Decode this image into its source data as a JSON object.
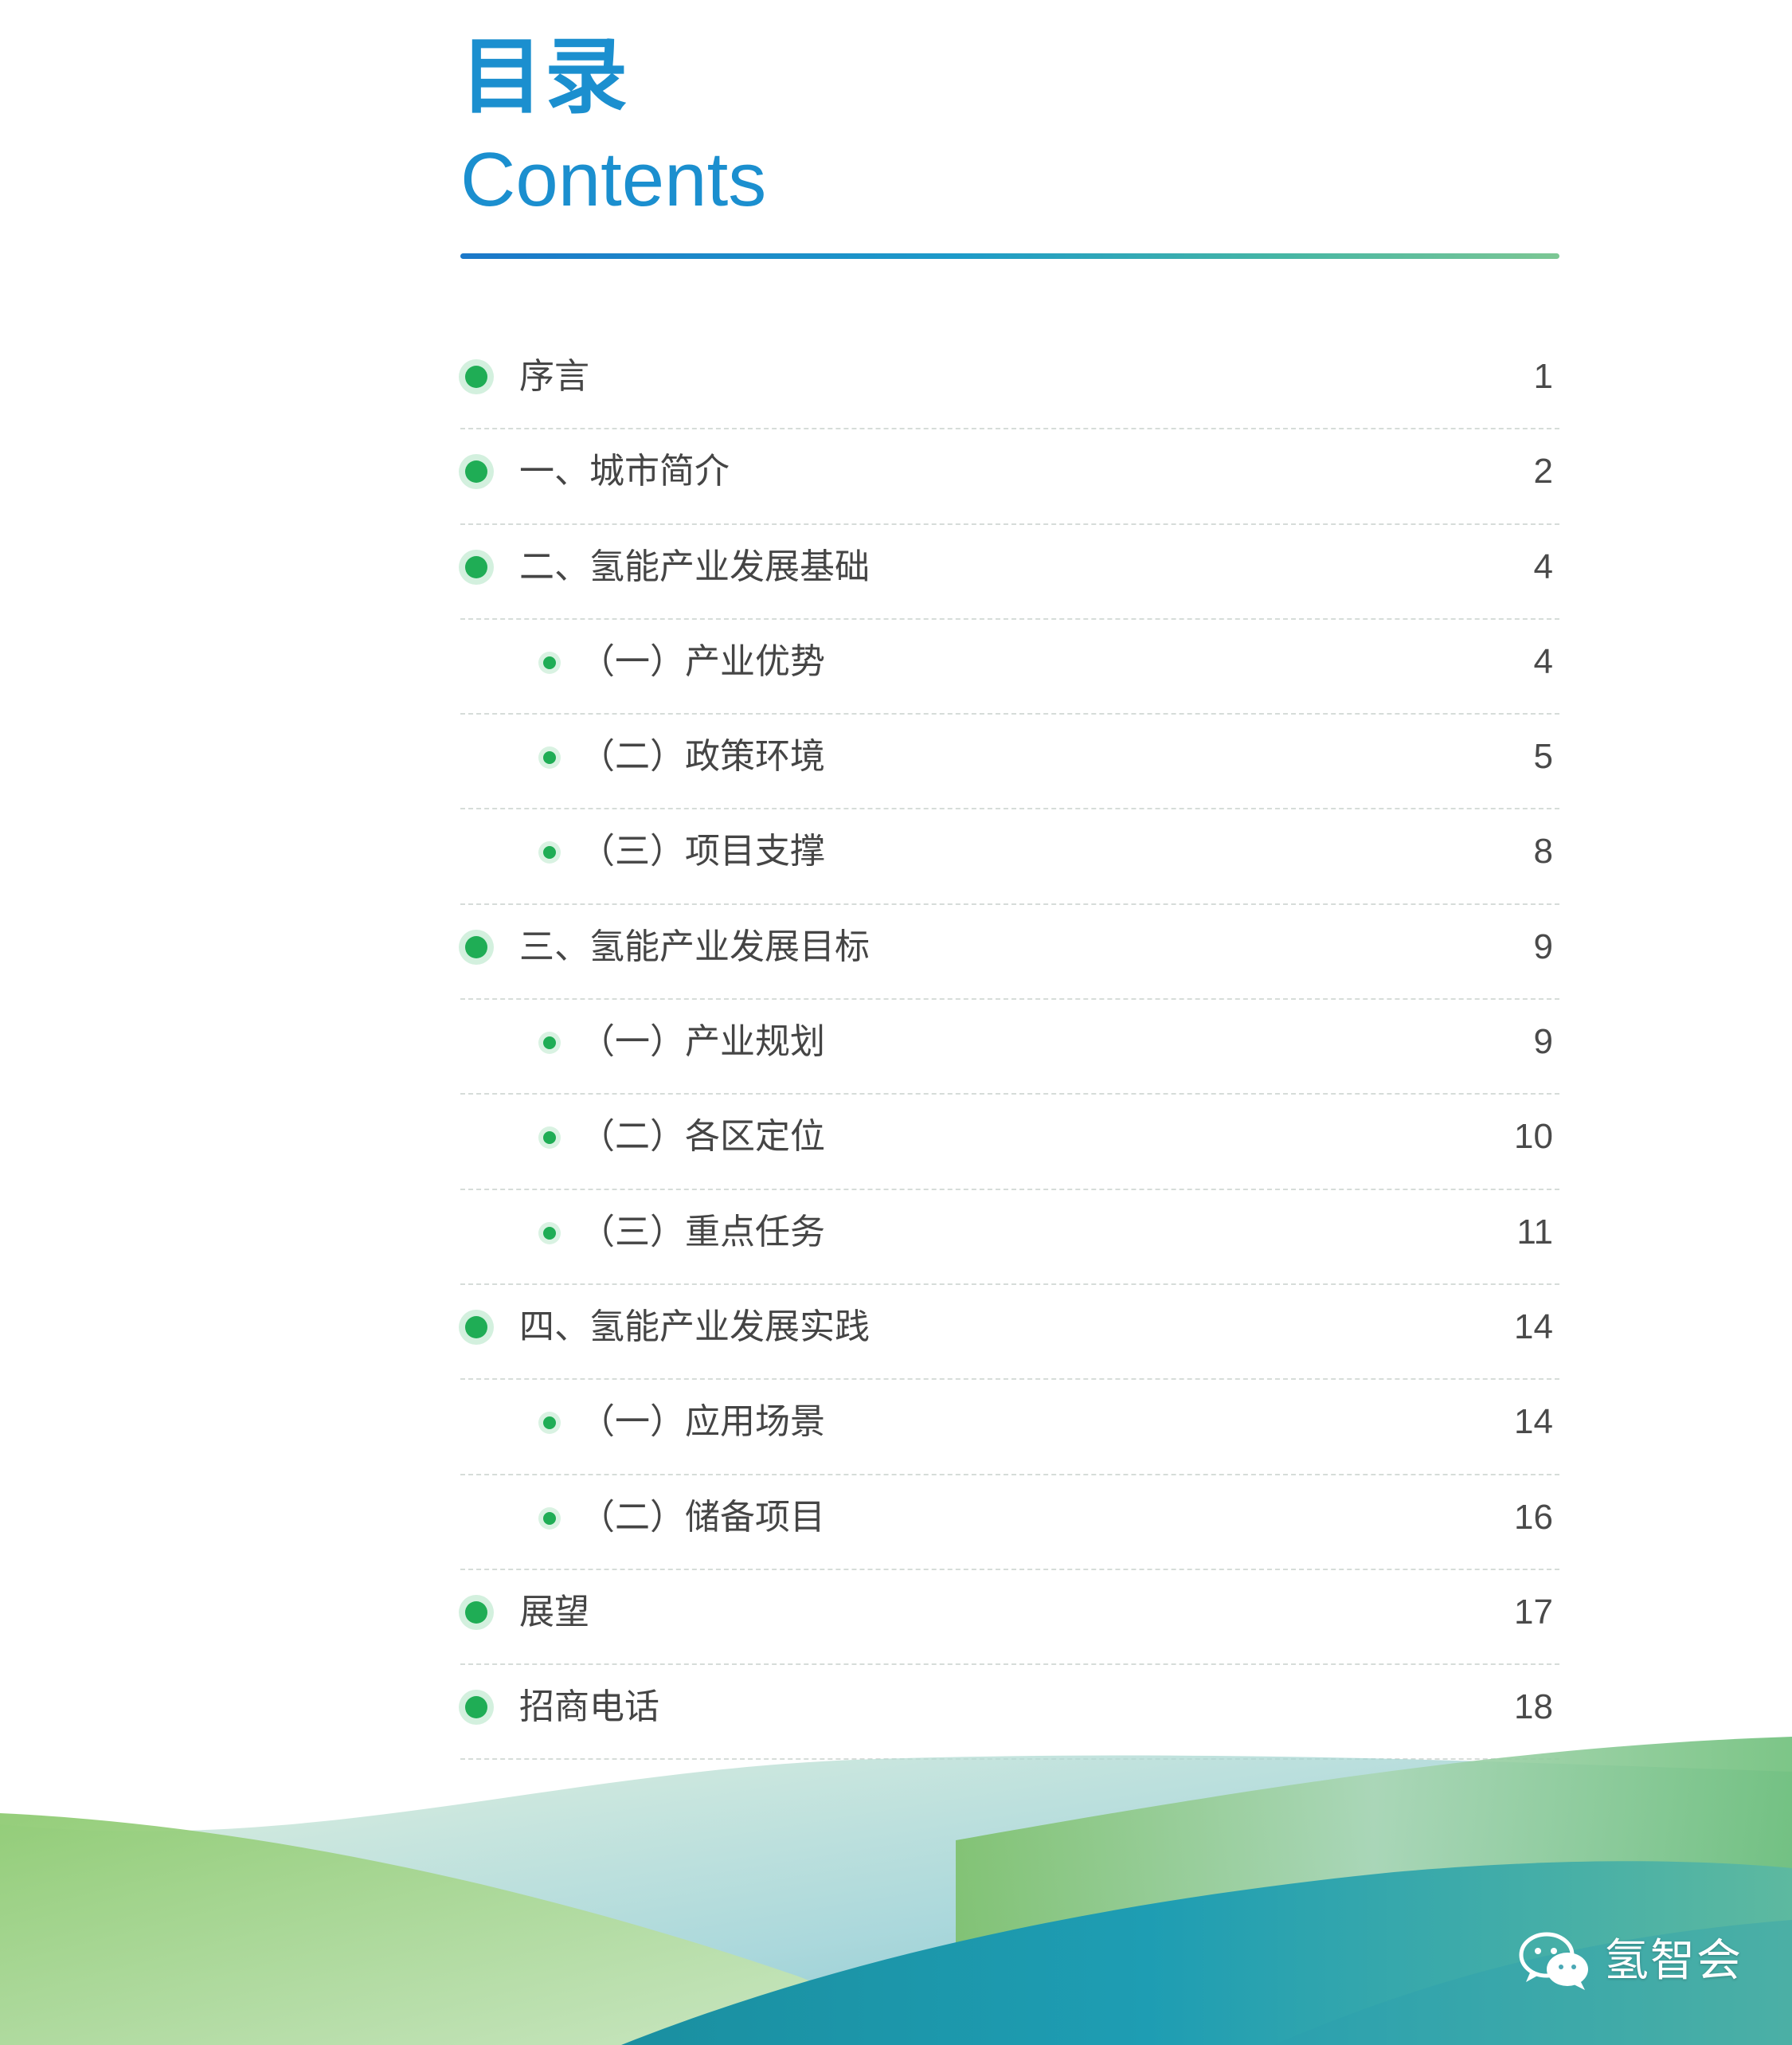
{
  "heading": {
    "title_zh": "目录",
    "title_en": "Contents"
  },
  "colors": {
    "title_blue": "#1b8fcf",
    "bullet_green": "#1fad55",
    "rule_start": "#1b78c9",
    "rule_end": "#7cc794"
  },
  "toc": [
    {
      "label": "序言",
      "page": "1",
      "level": 1
    },
    {
      "label": "一、城市简介",
      "page": "2",
      "level": 1
    },
    {
      "label": "二、氢能产业发展基础",
      "page": "4",
      "level": 1
    },
    {
      "label": "（一）产业优势",
      "page": "4",
      "level": 2
    },
    {
      "label": "（二）政策环境",
      "page": "5",
      "level": 2
    },
    {
      "label": "（三）项目支撑",
      "page": "8",
      "level": 2
    },
    {
      "label": "三、氢能产业发展目标",
      "page": "9",
      "level": 1
    },
    {
      "label": "（一）产业规划",
      "page": "9",
      "level": 2
    },
    {
      "label": "（二）各区定位",
      "page": "10",
      "level": 2
    },
    {
      "label": "（三）重点任务",
      "page": "11",
      "level": 2
    },
    {
      "label": "四、氢能产业发展实践",
      "page": "14",
      "level": 1
    },
    {
      "label": "（一）应用场景",
      "page": "14",
      "level": 2
    },
    {
      "label": "（二）储备项目",
      "page": "16",
      "level": 2
    },
    {
      "label": "展望",
      "page": "17",
      "level": 1
    },
    {
      "label": "招商电话",
      "page": "18",
      "level": 1
    }
  ],
  "watermark": {
    "icon": "wechat-icon",
    "text": "氢智会"
  }
}
